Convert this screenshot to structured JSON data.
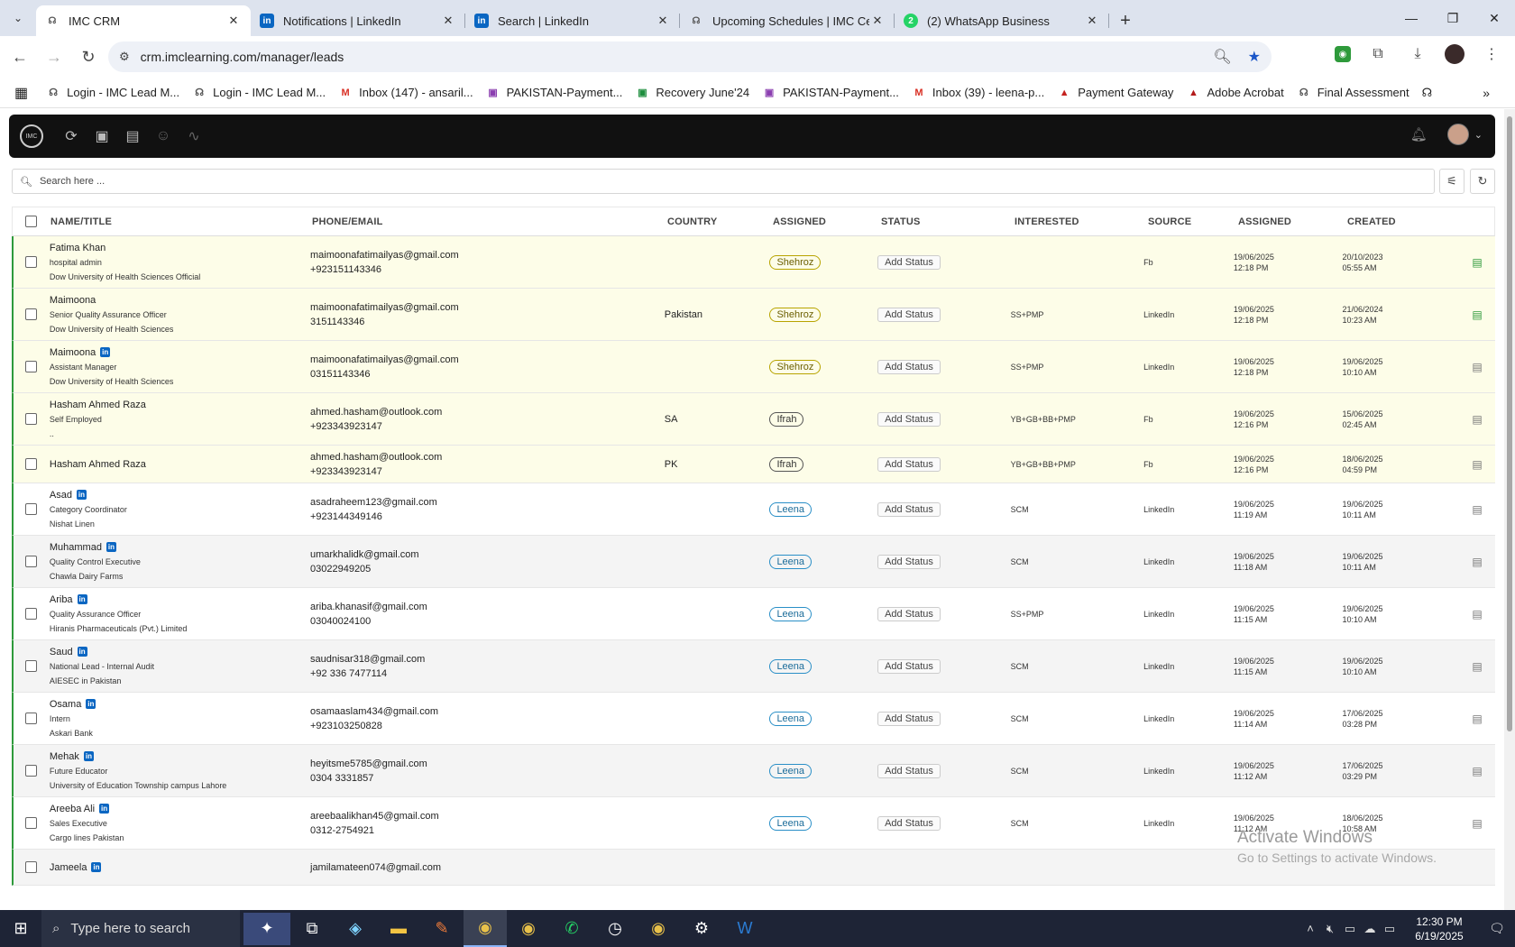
{
  "browser": {
    "tabs": [
      {
        "title": "IMC CRM",
        "icon": "imc-favicon",
        "active": true
      },
      {
        "title": "Notifications | LinkedIn",
        "icon": "linkedin-favicon",
        "active": false
      },
      {
        "title": "Search | LinkedIn",
        "icon": "linkedin-favicon",
        "active": false
      },
      {
        "title": "Upcoming Schedules | IMC Certi",
        "icon": "imc-favicon",
        "active": false
      },
      {
        "title": "(2) WhatsApp Business",
        "icon": "whatsapp-favicon",
        "active": false
      }
    ],
    "url": "crm.imclearning.com/manager/leads",
    "bookmarks": [
      "Login - IMC Lead M...",
      "Login - IMC Lead M...",
      "Inbox (147) - ansaril...",
      "PAKISTAN-Payment...",
      "Recovery June'24",
      "PAKISTAN-Payment...",
      "Inbox (39) - leena-p...",
      "Payment Gateway",
      "Adobe Acrobat",
      "Final Assessment"
    ]
  },
  "crm": {
    "search_placeholder": "Search here ...",
    "columns": [
      "NAME/TITLE",
      "PHONE/EMAIL",
      "COUNTRY",
      "ASSIGNED",
      "STATUS",
      "INTERESTED",
      "SOURCE",
      "ASSIGNED",
      "CREATED"
    ],
    "rows": [
      {
        "name": "Fatima Khan",
        "li": false,
        "title": "hospital admin",
        "org": "Dow University of Health Sciences Official",
        "email": "maimoonafatimailyas@gmail.com",
        "phone": "+923151143346",
        "country": "",
        "assigned": "Shehroz",
        "status": "Add Status",
        "interested": "",
        "source": "Fb",
        "assigned_date": "19/06/2025",
        "assigned_time": "12:18 PM",
        "created_date": "20/10/2023",
        "created_time": "05:55 AM",
        "bg": "y",
        "doc": "gr"
      },
      {
        "name": "Maimoona",
        "li": false,
        "title": "Senior Quality Assurance Officer",
        "org": "Dow University of Health Sciences",
        "email": "maimoonafatimailyas@gmail.com",
        "phone": "3151143346",
        "country": "Pakistan",
        "assigned": "Shehroz",
        "status": "Add Status",
        "interested": "SS+PMP",
        "source": "LinkedIn",
        "assigned_date": "19/06/2025",
        "assigned_time": "12:18 PM",
        "created_date": "21/06/2024",
        "created_time": "10:23 AM",
        "bg": "y",
        "doc": "gr"
      },
      {
        "name": "Maimoona",
        "li": true,
        "title": "Assistant Manager",
        "org": "Dow University of Health Sciences",
        "email": "maimoonafatimailyas@gmail.com",
        "phone": "03151143346",
        "country": "",
        "assigned": "Shehroz",
        "status": "Add Status",
        "interested": "SS+PMP",
        "source": "LinkedIn",
        "assigned_date": "19/06/2025",
        "assigned_time": "12:18 PM",
        "created_date": "19/06/2025",
        "created_time": "10:10 AM",
        "bg": "y",
        "doc": ""
      },
      {
        "name": "Hasham Ahmed Raza",
        "li": false,
        "title": "Self Employed",
        "org": "..",
        "email": "ahmed.hasham@outlook.com",
        "phone": "+923343923147",
        "country": "SA",
        "assigned": "Ifrah",
        "status": "Add Status",
        "interested": "YB+GB+BB+PMP",
        "source": "Fb",
        "assigned_date": "19/06/2025",
        "assigned_time": "12:16 PM",
        "created_date": "15/06/2025",
        "created_time": "02:45 AM",
        "bg": "y",
        "doc": ""
      },
      {
        "name": "Hasham Ahmed Raza",
        "li": false,
        "title": "",
        "org": "",
        "email": "ahmed.hasham@outlook.com",
        "phone": "+923343923147",
        "country": "PK",
        "assigned": "Ifrah",
        "status": "Add Status",
        "interested": "YB+GB+BB+PMP",
        "source": "Fb",
        "assigned_date": "19/06/2025",
        "assigned_time": "12:16 PM",
        "created_date": "18/06/2025",
        "created_time": "04:59 PM",
        "bg": "y",
        "doc": ""
      },
      {
        "name": "Asad",
        "li": true,
        "title": "Category Coordinator",
        "org": "Nishat Linen",
        "email": "asadraheem123@gmail.com",
        "phone": "+923144349146",
        "country": "",
        "assigned": "Leena",
        "status": "Add Status",
        "interested": "SCM",
        "source": "LinkedIn",
        "assigned_date": "19/06/2025",
        "assigned_time": "11:19 AM",
        "created_date": "19/06/2025",
        "created_time": "10:11 AM",
        "bg": "w",
        "doc": ""
      },
      {
        "name": "Muhammad",
        "li": true,
        "title": "Quality Control Executive",
        "org": "Chawla Dairy Farms",
        "email": "umarkhalidk@gmail.com",
        "phone": "03022949205",
        "country": "",
        "assigned": "Leena",
        "status": "Add Status",
        "interested": "SCM",
        "source": "LinkedIn",
        "assigned_date": "19/06/2025",
        "assigned_time": "11:18 AM",
        "created_date": "19/06/2025",
        "created_time": "10:11 AM",
        "bg": "g",
        "doc": ""
      },
      {
        "name": "Ariba",
        "li": true,
        "title": "Quality Assurance Officer",
        "org": "Hiranis Pharmaceuticals (Pvt.) Limited",
        "email": "ariba.khanasif@gmail.com",
        "phone": "03040024100",
        "country": "",
        "assigned": "Leena",
        "status": "Add Status",
        "interested": "SS+PMP",
        "source": "LinkedIn",
        "assigned_date": "19/06/2025",
        "assigned_time": "11:15 AM",
        "created_date": "19/06/2025",
        "created_time": "10:10 AM",
        "bg": "w",
        "doc": ""
      },
      {
        "name": "Saud",
        "li": true,
        "title": "National Lead - Internal Audit",
        "org": "AIESEC in Pakistan",
        "email": "saudnisar318@gmail.com",
        "phone": "+92 336 7477114",
        "country": "",
        "assigned": "Leena",
        "status": "Add Status",
        "interested": "SCM",
        "source": "LinkedIn",
        "assigned_date": "19/06/2025",
        "assigned_time": "11:15 AM",
        "created_date": "19/06/2025",
        "created_time": "10:10 AM",
        "bg": "g",
        "doc": ""
      },
      {
        "name": "Osama",
        "li": true,
        "title": "Intern",
        "org": "Askari Bank",
        "email": "osamaaslam434@gmail.com",
        "phone": "+923103250828",
        "country": "",
        "assigned": "Leena",
        "status": "Add Status",
        "interested": "SCM",
        "source": "LinkedIn",
        "assigned_date": "19/06/2025",
        "assigned_time": "11:14 AM",
        "created_date": "17/06/2025",
        "created_time": "03:28 PM",
        "bg": "w",
        "doc": ""
      },
      {
        "name": "Mehak",
        "li": true,
        "title": "Future Educator",
        "org": "University of Education Township campus Lahore",
        "email": "heyitsme5785@gmail.com",
        "phone": "0304 3331857",
        "country": "",
        "assigned": "Leena",
        "status": "Add Status",
        "interested": "SCM",
        "source": "LinkedIn",
        "assigned_date": "19/06/2025",
        "assigned_time": "11:12 AM",
        "created_date": "17/06/2025",
        "created_time": "03:29 PM",
        "bg": "g",
        "doc": ""
      },
      {
        "name": "Areeba Ali",
        "li": true,
        "title": "Sales Executive",
        "org": "Cargo lines Pakistan",
        "email": "areebaalikhan45@gmail.com",
        "phone": "0312-2754921",
        "country": "",
        "assigned": "Leena",
        "status": "Add Status",
        "interested": "SCM",
        "source": "LinkedIn",
        "assigned_date": "19/06/2025",
        "assigned_time": "11:12 AM",
        "created_date": "18/06/2025",
        "created_time": "10:58 AM",
        "bg": "w",
        "doc": ""
      },
      {
        "name": "Jameela",
        "li": true,
        "title": "",
        "org": "",
        "email": "jamilamateen074@gmail.com",
        "phone": "",
        "country": "",
        "assigned": "",
        "status": "",
        "interested": "",
        "source": "",
        "assigned_date": "",
        "assigned_time": "",
        "created_date": "",
        "created_time": "",
        "bg": "g",
        "doc": ""
      }
    ]
  },
  "watermark": {
    "line1": "Activate Windows",
    "line2": "Go to Settings to activate Windows."
  },
  "taskbar": {
    "search_placeholder": "Type here to search",
    "time": "12:30 PM",
    "date": "6/19/2025"
  }
}
